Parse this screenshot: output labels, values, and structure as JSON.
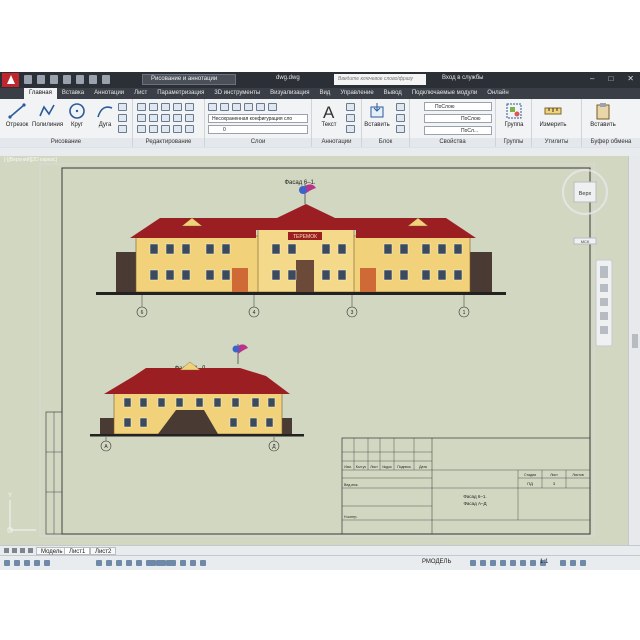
{
  "window": {
    "app_tab": "Рисование и аннотации",
    "doc_title": "dwg.dwg",
    "search_placeholder": "Введите ключевое слово/фразу",
    "login": "Вход в службы"
  },
  "tabs": [
    "Главная",
    "Вставка",
    "Аннотации",
    "Лист",
    "Параметризация",
    "3D инструменты",
    "Визуализация",
    "Вид",
    "Управление",
    "Вывод",
    "Подключаемые модули",
    "Онлайн"
  ],
  "ribbon": {
    "draw": {
      "title": "Рисование",
      "line": "Отрезок",
      "polyline": "Полилиния",
      "circle": "Круг",
      "arc": "Дуга"
    },
    "modify": {
      "title": "Редактирование"
    },
    "layers": {
      "title": "Слои",
      "layer_state": "Несохраненная конфигурация сло",
      "current_layer": "0"
    },
    "annotation": {
      "title": "Аннотации",
      "text": "Текст"
    },
    "block": {
      "title": "Блок",
      "insert": "Вставить"
    },
    "properties": {
      "title": "Свойства",
      "color": "ПоСлою",
      "linetype": "ПоСлою",
      "lineweight": "ПоСл..."
    },
    "groups": {
      "title": "Группы",
      "group": "Группа"
    },
    "utilities": {
      "title": "Утилиты",
      "measure": "Измерить"
    },
    "clipboard": {
      "title": "Буфер обмена",
      "paste": "Вставить"
    }
  },
  "viewport": {
    "label": "[-][Верхний][2D каркас]",
    "viewcube": "Верх",
    "wcs": "МСК"
  },
  "drawing": {
    "facade_top_title": "Фасад 6–1.",
    "facade_bottom_title": "Фасад А–Д",
    "sign_text": "ТЕРЕМОК",
    "axes_top": [
      "6",
      "4",
      "3",
      "1"
    ],
    "axes_bottom": [
      "А",
      "Д"
    ],
    "title_block_headers": [
      "Изм.",
      "Кол.уч",
      "Лист",
      "№док",
      "Подпись",
      "Дата"
    ],
    "title_block_rows": [
      "Вед.инж.",
      "Н.контр."
    ],
    "stage_headers": [
      "Стадия",
      "Лист",
      "Листов"
    ],
    "stage_values": [
      "ПД",
      "3",
      ""
    ],
    "sheet_titles": [
      "Фасад 6–1.",
      "Фасад А–Д"
    ]
  },
  "layout_tabs": [
    "Модель",
    "Лист1",
    "Лист2"
  ],
  "status": {
    "mode": "РМОДЕЛЬ",
    "scale": "1:1"
  },
  "colors": {
    "roof": "#9b1e22",
    "wall": "#f1d27a",
    "window": "#3b4a5c",
    "canvas": "#d2d7c2",
    "ground": "#222222"
  }
}
